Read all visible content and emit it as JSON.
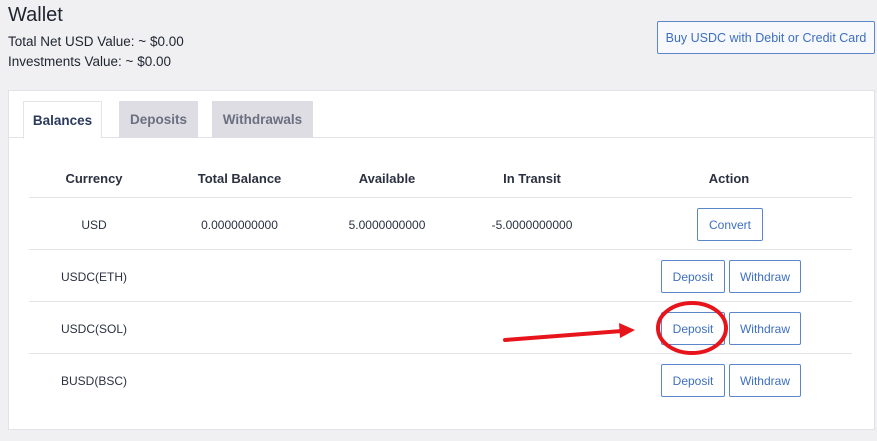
{
  "page": {
    "title": "Wallet",
    "total_net_usd": "Total Net USD Value: ~ $0.00",
    "investments": "Investments Value: ~ $0.00",
    "buy_button": "Buy USDC with Debit or Credit Card"
  },
  "tabs": [
    {
      "label": "Balances",
      "active": true
    },
    {
      "label": "Deposits",
      "active": false
    },
    {
      "label": "Withdrawals",
      "active": false
    }
  ],
  "table": {
    "headers": [
      "Currency",
      "Total Balance",
      "Available",
      "In Transit",
      "Action"
    ],
    "rows": [
      {
        "currency": "USD",
        "total": "0.0000000000",
        "available": "5.0000000000",
        "in_transit": "-5.0000000000",
        "actions": [
          "Convert"
        ]
      },
      {
        "currency": "USDC(ETH)",
        "total": "",
        "available": "",
        "in_transit": "",
        "actions": [
          "Deposit",
          "Withdraw"
        ]
      },
      {
        "currency": "USDC(SOL)",
        "total": "",
        "available": "",
        "in_transit": "",
        "actions": [
          "Deposit",
          "Withdraw"
        ]
      },
      {
        "currency": "BUSD(BSC)",
        "total": "",
        "available": "",
        "in_transit": "",
        "actions": [
          "Deposit",
          "Withdraw"
        ]
      }
    ]
  },
  "colors": {
    "accent": "#3d6fc0",
    "annotation": "#e8141b"
  }
}
